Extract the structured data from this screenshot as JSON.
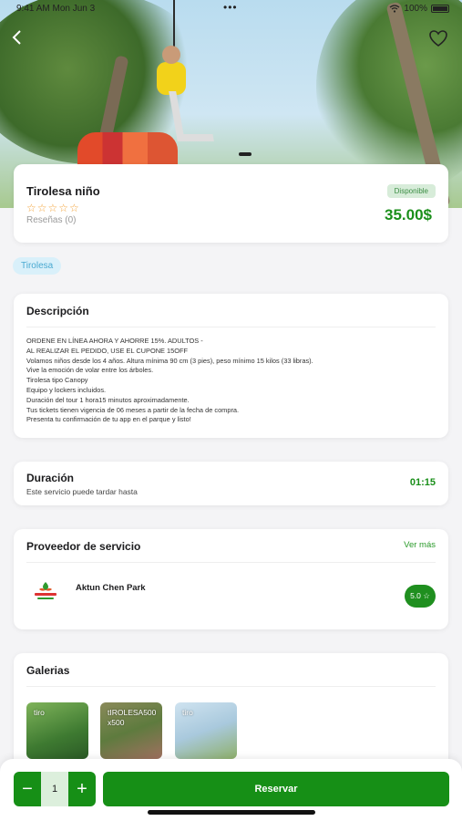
{
  "status_bar": {
    "time": "9:41 AM",
    "date": "Mon Jun 3",
    "dots": "•••",
    "battery": "100%"
  },
  "nav": {
    "back_icon": "chevron-left-icon",
    "favorite_icon": "heart-outline-icon"
  },
  "summary": {
    "title": "Tirolesa niño",
    "stars": "☆☆☆☆☆",
    "reviews": "Reseñas (0)",
    "availability": "Disponible",
    "price": "35.00$"
  },
  "category_tag": "Tirolesa",
  "description": {
    "title": "Descripción",
    "lines": [
      "ORDENE EN LÍNEA AHORA Y AHORRE 15%. ADULTOS -",
      "AL REALIZAR EL PEDIDO, USE EL CUPONE 15OFF",
      "Volamos niños desde los 4 años. Altura mínima 90 cm (3 pies), peso mínimo 15 kilos (33 libras).",
      "Vive la emoción de volar entre los árboles.",
      "Tirolesa tipo Canopy",
      "Equipo y lockers incluidos.",
      "Duración del tour 1 hora15 minutos aproximadamente.",
      "Tus tickets tienen vigencia de 06 meses a partir de la fecha de compra.",
      "Presenta tu confirmación de tu app en el parque y listo!"
    ]
  },
  "duration": {
    "title": "Duración",
    "subtitle": "Este servicio puede tardar hasta",
    "value": "01:15"
  },
  "provider": {
    "title": "Proveedor de servicio",
    "see_more": "Ver más",
    "name": "Aktun Chen Park",
    "rating": "5.0 ☆"
  },
  "gallery": {
    "title": "Galerias",
    "items": [
      "tiro",
      "tIROLESA500 x500",
      "tiro"
    ]
  },
  "bottom": {
    "minus": "−",
    "quantity": "1",
    "plus": "+",
    "reserve": "Reservar"
  },
  "colors": {
    "accent": "#168f16",
    "price": "#1a8f1a",
    "tag_bg": "#d9f0fa",
    "tag_text": "#4aa9d1"
  }
}
